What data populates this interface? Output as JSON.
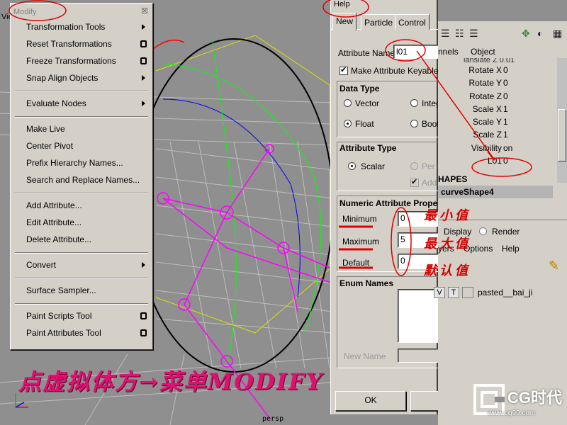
{
  "viewport": {
    "menu_fragment": "Vie",
    "camera_label": "persp"
  },
  "modify_menu": {
    "title": "Modify",
    "close_glyph": "☒",
    "items": [
      {
        "label": "Transformation Tools",
        "type": "submenu"
      },
      {
        "label": "Reset Transformations",
        "type": "option"
      },
      {
        "label": "Freeze Transformations",
        "type": "option"
      },
      {
        "label": "Snap Align Objects",
        "type": "submenu"
      },
      {
        "type": "separator"
      },
      {
        "label": "Evaluate Nodes",
        "type": "submenu"
      },
      {
        "type": "separator"
      },
      {
        "label": "Make Live",
        "type": "plain"
      },
      {
        "label": "Center Pivot",
        "type": "plain"
      },
      {
        "label": "Prefix Hierarchy Names...",
        "type": "plain"
      },
      {
        "label": "Search and Replace Names...",
        "type": "plain"
      },
      {
        "type": "separator"
      },
      {
        "label": "Add Attribute...",
        "type": "plain"
      },
      {
        "label": "Edit Attribute...",
        "type": "plain"
      },
      {
        "label": "Delete Attribute...",
        "type": "plain"
      },
      {
        "type": "separator"
      },
      {
        "label": "Convert",
        "type": "submenu"
      },
      {
        "type": "separator"
      },
      {
        "label": "Surface Sampler...",
        "type": "plain"
      },
      {
        "type": "separator"
      },
      {
        "label": "Paint Scripts Tool",
        "type": "option"
      },
      {
        "label": "Paint Attributes Tool",
        "type": "option"
      }
    ]
  },
  "attr_dialog": {
    "menubar": "Help",
    "tabs": [
      "New",
      "Particle",
      "Control"
    ],
    "attribute_name_label": "Attribute Name",
    "attribute_name_value": "l01",
    "keyable_label": "Make Attribute Keyable",
    "data_type": {
      "title": "Data Type",
      "options": [
        "Vector",
        "Integ",
        "Float",
        "Bool"
      ]
    },
    "attribute_type": {
      "title": "Attribute Type",
      "options": [
        "Scalar",
        "Per i",
        "Add"
      ]
    },
    "numeric": {
      "title": "Numeric Attribute Proper",
      "minimum_label": "Minimum",
      "minimum_value": "0",
      "maximum_label": "Maximum",
      "maximum_value": "5",
      "default_label": "Default",
      "default_value": "0"
    },
    "enum": {
      "title": "Enum Names",
      "new_name_label": "New Name"
    },
    "ok_label": "OK"
  },
  "channel_box": {
    "header": {
      "channels": "nnels",
      "object": "Object"
    },
    "partial_row": "lanslate Z  0.01",
    "rows": [
      {
        "name": "Rotate X",
        "value": "0"
      },
      {
        "name": "Rotate Y",
        "value": "0"
      },
      {
        "name": "Rotate Z",
        "value": "0"
      },
      {
        "name": "Scale X",
        "value": "1"
      },
      {
        "name": "Scale Y",
        "value": "1"
      },
      {
        "name": "Scale Z",
        "value": "1"
      },
      {
        "name": "Visibility",
        "value": "on"
      },
      {
        "name": "L01",
        "value": "0"
      }
    ],
    "shapes_title": "HAPES",
    "shape_name": "curveShape4",
    "layers": {
      "display_label": "Display",
      "render_label": "Render",
      "menu": [
        "yers",
        "Options",
        "Help"
      ],
      "layer_v": "V",
      "layer_t": "T",
      "layer_name": "pasted__bai_ji"
    }
  },
  "annotations": {
    "minimum_cn": "最小值",
    "maximum_cn": "最大值",
    "default_cn": "默认值",
    "caption": "点虚拟体方→菜单MODIFY"
  },
  "watermark": {
    "brand": "CG时代",
    "url": "www.cg99.com"
  }
}
